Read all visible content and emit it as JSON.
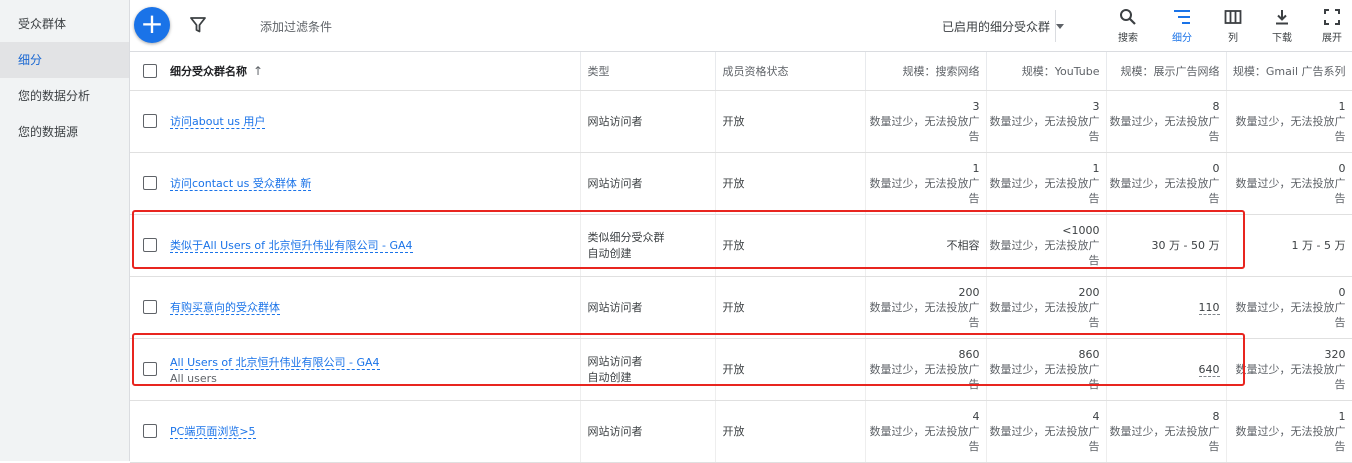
{
  "sidebar": {
    "items": [
      {
        "label": "受众群体"
      },
      {
        "label": "细分"
      },
      {
        "label": "您的数据分析"
      },
      {
        "label": "您的数据源"
      }
    ]
  },
  "toolbar": {
    "add_icon": "+",
    "filter_placeholder": "添加过滤条件",
    "view_select": "已启用的细分受众群",
    "buttons": [
      {
        "label": "搜索",
        "icon": "search-icon"
      },
      {
        "label": "细分",
        "icon": "segment-icon"
      },
      {
        "label": "列",
        "icon": "columns-icon"
      },
      {
        "label": "下载",
        "icon": "download-icon"
      },
      {
        "label": "展开",
        "icon": "expand-icon"
      }
    ]
  },
  "table": {
    "headers": {
      "name": "细分受众群名称",
      "sort_arrow": "↑",
      "type": "类型",
      "status": "成员资格状态",
      "search": "规模：搜索网络",
      "youtube": "规模：YouTube",
      "display": "规模：展示广告网络",
      "gmail": "规模：Gmail 广告系列"
    },
    "rows": [
      {
        "name": "访问about us 用户",
        "subline": "",
        "type": "网站访问者",
        "type_sub": "",
        "status": "开放",
        "search": "3",
        "search_note": "数量过少，无法投放广告",
        "youtube": "3",
        "youtube_note": "数量过少，无法投放广告",
        "display": "8",
        "display_note": "数量过少，无法投放广告",
        "gmail": "1",
        "gmail_note": "数量过少，无法投放广告"
      },
      {
        "name": "访问contact us 受众群体 新",
        "subline": "",
        "type": "网站访问者",
        "type_sub": "",
        "status": "开放",
        "search": "1",
        "search_note": "数量过少，无法投放广告",
        "youtube": "1",
        "youtube_note": "数量过少，无法投放广告",
        "display": "0",
        "display_note": "数量过少，无法投放广告",
        "gmail": "0",
        "gmail_note": "数量过少，无法投放广告"
      },
      {
        "name": "类似于All Users of 北京恒升伟业有限公司 - GA4",
        "subline": "",
        "type": "类似细分受众群",
        "type_sub": "自动创建",
        "status": "开放",
        "search": "不相容",
        "search_note": "",
        "youtube": "<1000",
        "youtube_note": "数量过少，无法投放广告",
        "display": "30 万 - 50 万",
        "display_note": "",
        "gmail": "1 万 - 5 万",
        "gmail_note": ""
      },
      {
        "name": "有购买意向的受众群体",
        "subline": "",
        "type": "网站访问者",
        "type_sub": "",
        "status": "开放",
        "search": "200",
        "search_note": "数量过少，无法投放广告",
        "youtube": "200",
        "youtube_note": "数量过少，无法投放广告",
        "display": "110",
        "display_note": "",
        "gmail": "0",
        "gmail_note": "数量过少，无法投放广告"
      },
      {
        "name": "All Users of 北京恒升伟业有限公司 - GA4",
        "subline": "All users",
        "type": "网站访问者",
        "type_sub": "自动创建",
        "status": "开放",
        "search": "860",
        "search_note": "数量过少，无法投放广告",
        "youtube": "860",
        "youtube_note": "数量过少，无法投放广告",
        "display": "640",
        "display_note": "",
        "gmail": "320",
        "gmail_note": "数量过少，无法投放广告"
      },
      {
        "name": "PC端页面浏览>5",
        "subline": "",
        "type": "网站访问者",
        "type_sub": "",
        "status": "开放",
        "search": "4",
        "search_note": "数量过少，无法投放广告",
        "youtube": "4",
        "youtube_note": "数量过少，无法投放广告",
        "display": "8",
        "display_note": "数量过少，无法投放广告",
        "gmail": "1",
        "gmail_note": "数量过少，无法投放广告"
      }
    ]
  },
  "colors": {
    "accent": "#1a73e8",
    "highlight_box": "#e8251f",
    "sidebar_bg": "#f1f3f4"
  }
}
